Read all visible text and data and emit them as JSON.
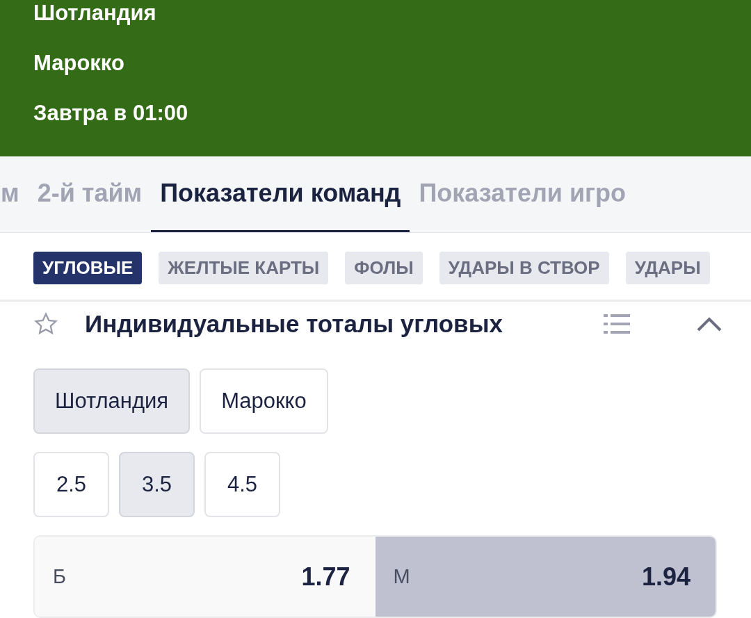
{
  "match": {
    "team_1": "Шотландия",
    "team_2": "Марокко",
    "time": "Завтра в 01:00"
  },
  "tabs": [
    {
      "label": "м",
      "selected": false
    },
    {
      "label": "2-й тайм",
      "selected": false
    },
    {
      "label": "Показатели команд",
      "selected": true
    },
    {
      "label": "Показатели игро",
      "selected": false
    }
  ],
  "categories": [
    {
      "label": "УГЛОВЫЕ",
      "selected": true
    },
    {
      "label": "ЖЕЛТЫЕ КАРТЫ",
      "selected": false
    },
    {
      "label": "ФОЛЫ",
      "selected": false
    },
    {
      "label": "УДАРЫ В СТВОР",
      "selected": false
    },
    {
      "label": "УДАРЫ",
      "selected": false
    }
  ],
  "market": {
    "title": "Индивидуальные тоталы угловых",
    "favorite": false,
    "expanded": true,
    "teams": [
      {
        "label": "Шотландия",
        "selected": true
      },
      {
        "label": "Марокко",
        "selected": false
      }
    ],
    "lines": [
      {
        "label": "2.5",
        "selected": false
      },
      {
        "label": "3.5",
        "selected": true
      },
      {
        "label": "4.5",
        "selected": false
      }
    ],
    "odds": [
      {
        "label": "Б",
        "value": "1.77",
        "selected": false
      },
      {
        "label": "М",
        "value": "1.94",
        "selected": true
      }
    ]
  }
}
